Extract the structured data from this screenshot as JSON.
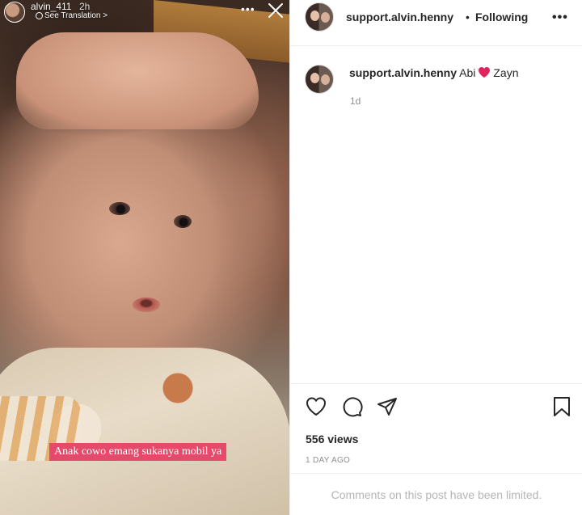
{
  "story": {
    "username": "alvin_411",
    "time": "2h",
    "see_translation": "See Translation >",
    "more_label": "•••",
    "caption": "Anak cowo emang sukanya mobil ya"
  },
  "post_header": {
    "username": "support.alvin.henny",
    "separator": "•",
    "following_label": "Following",
    "more_label": "•••"
  },
  "caption_comment": {
    "username": "support.alvin.henny",
    "text_before": "Abi",
    "emoji": "heart-emoji",
    "text_after": "Zayn",
    "time_ago": "1d"
  },
  "actions": {
    "icons": [
      "heart-icon",
      "comment-icon",
      "share-icon",
      "bookmark-icon"
    ]
  },
  "stats": {
    "views": "556 views",
    "date": "1 DAY AGO"
  },
  "footer": {
    "comments_limited": "Comments on this post have been limited."
  },
  "colors": {
    "heart_emoji": "#e0245e",
    "caption_sticker_bg": "#e64a6a",
    "muted_text": "#8e8e8e"
  }
}
